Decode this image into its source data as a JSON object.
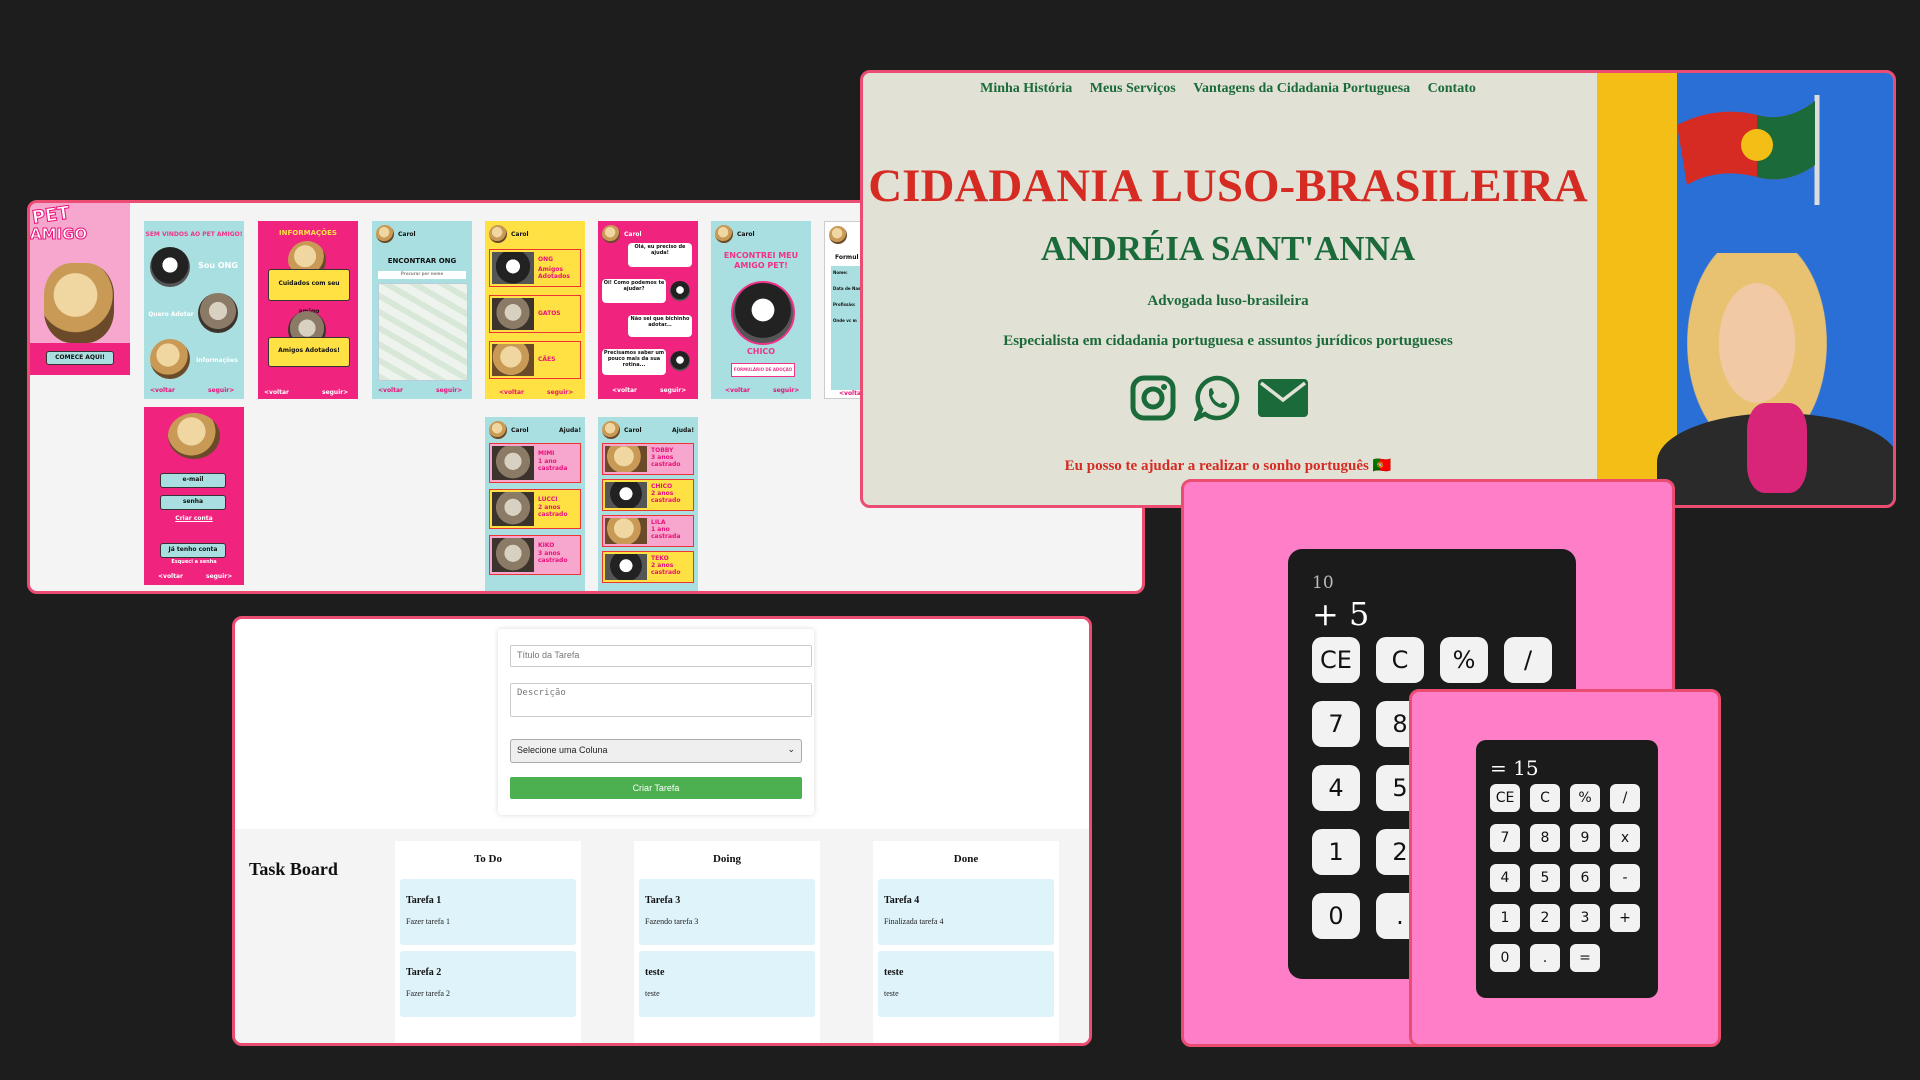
{
  "pet": {
    "logo_pet": "PET",
    "logo_amigo": "AMIGO",
    "start_button": "COMECE AQUI!",
    "welcome": "SEM VINDOS AO PET AMIGO!",
    "sou_ong": "Sou ONG",
    "quero_adotar": "Quero Adotar",
    "informacoes": "Informações",
    "nav_back": "<voltar",
    "nav_next": "seguir>",
    "info_title": "INFORMAÇÕES",
    "info_care": "Cuidados com seu amigo",
    "info_adopted": "Amigos Adotados!",
    "user_name": "Carol",
    "find_ong": "ENCONTRAR ONG",
    "search_placeholder": "Procurar por nome",
    "categories": [
      "ONG",
      "GATOS",
      "CÃES"
    ],
    "ong_sub": "Amigos Adotados",
    "chat": [
      "Olá, eu preciso de ajuda!",
      "Oi! Como podemos te ajudar?",
      "Não sei que bichinho adotar...",
      "Precisamos saber um pouco mais da sua rotina..."
    ],
    "found_title": "ENCONTREI MEU AMIGO PET!",
    "found_name": "CHICO",
    "found_form": "FORMULÁRIO DE ADOÇÃO",
    "form_title": "Formul",
    "form_fields": [
      "Nome:",
      "Data de Nasc",
      "Profissão:",
      "Onde vc m"
    ],
    "login_email": "e-mail",
    "login_pass": "senha",
    "create_account": "Criar conta",
    "have_account": "Já tenho conta",
    "forgot": "Esqueci a senha",
    "help": "Ajuda!",
    "cats_list": [
      {
        "name": "MIMI",
        "info": "1 ano castrada"
      },
      {
        "name": "LUCCI",
        "info": "2 anos castrado"
      },
      {
        "name": "KIKO",
        "info": "3 anos castrado"
      }
    ],
    "dogs_list": [
      {
        "name": "TOBBY",
        "info": "3 anos castrado"
      },
      {
        "name": "CHICO",
        "info": "2 anos castrado"
      },
      {
        "name": "LILA",
        "info": "1 ano castrada"
      },
      {
        "name": "TEKO",
        "info": "2 anos castrado"
      }
    ]
  },
  "cidadania": {
    "nav": [
      "Minha História",
      "Meus Serviços",
      "Vantagens da Cidadania Portuguesa",
      "Contato"
    ],
    "title": "CIDADANIA LUSO-BRASILEIRA",
    "name": "ANDRÉIA SANT'ANNA",
    "role": "Advogada luso-brasileira",
    "specialty": "Especialista em cidadania portuguesa e assuntos jurídicos portugueses",
    "cta": "Eu posso te ajudar a realizar o sonho português 🇵🇹",
    "icons": [
      "instagram-icon",
      "whatsapp-icon",
      "email-icon"
    ]
  },
  "taskboard": {
    "title_placeholder": "Título da Tarefa",
    "desc_placeholder": "Descrição",
    "select_value": "Selecione uma Coluna",
    "create_button": "Criar Tarefa",
    "board_title": "Task Board",
    "columns": [
      {
        "name": "To Do",
        "tasks": [
          {
            "title": "Tarefa 1",
            "desc": "Fazer tarefa 1"
          },
          {
            "title": "Tarefa 2",
            "desc": "Fazer tarefa 2"
          }
        ]
      },
      {
        "name": "Doing",
        "tasks": [
          {
            "title": "Tarefa 3",
            "desc": "Fazendo tarefa 3"
          },
          {
            "title": "teste",
            "desc": "teste"
          }
        ]
      },
      {
        "name": "Done",
        "tasks": [
          {
            "title": "Tarefa 4",
            "desc": "Finalizada tarefa 4"
          },
          {
            "title": "teste",
            "desc": "teste"
          }
        ]
      }
    ]
  },
  "calc1": {
    "previous": "10",
    "current": "+ 5",
    "keys": [
      "CE",
      "C",
      "%",
      "/",
      "7",
      "8",
      "4",
      "5",
      "1",
      "2",
      "0",
      "."
    ]
  },
  "calc2": {
    "current": "= 15",
    "keys": [
      "CE",
      "C",
      "%",
      "/",
      "7",
      "8",
      "9",
      "x",
      "4",
      "5",
      "6",
      "-",
      "1",
      "2",
      "3",
      "+",
      "0",
      ".",
      "="
    ]
  },
  "colors": {
    "frame_border": "#ea4c72",
    "pet_pink": "#f0237f",
    "pet_teal": "#a9dfe0",
    "pet_yellow": "#ffe144",
    "cid_green": "#1b6b3a",
    "cid_red": "#d52b22",
    "task_green": "#4caf50",
    "calc_pink": "#fe7fc8"
  }
}
